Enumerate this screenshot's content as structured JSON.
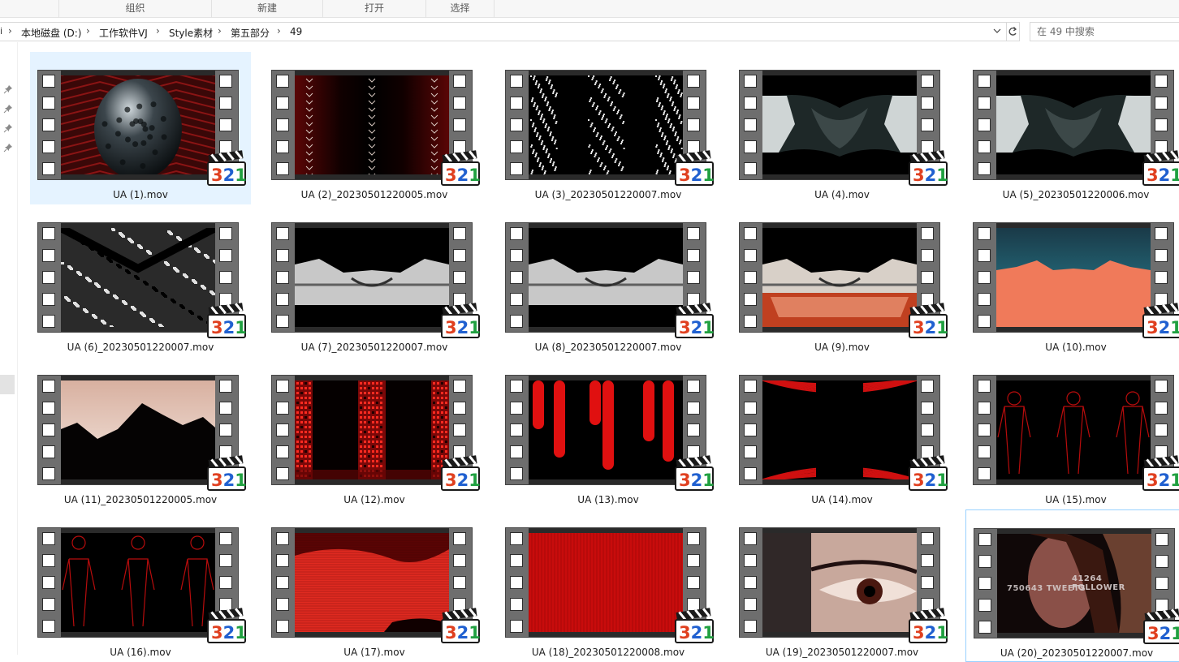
{
  "ribbon": {
    "groups": [
      "组织",
      "新建",
      "打开",
      "选择"
    ]
  },
  "address_bar": {
    "breadcrumbs": [
      "本地磁盘 (D:)",
      "工作软件VJ",
      "Style素材",
      "第五部分",
      "49"
    ]
  },
  "search": {
    "placeholder": "在 49 中搜索"
  },
  "files": [
    {
      "name": "UA (1).mov",
      "preview": "orb"
    },
    {
      "name": "UA (2)_20230501220005.mov",
      "preview": "dark-red-symmetry"
    },
    {
      "name": "UA (3)_20230501220007.mov",
      "preview": "white-noise-columns"
    },
    {
      "name": "UA (4).mov",
      "preview": "grey-cave"
    },
    {
      "name": "UA (5)_20230501220006.mov",
      "preview": "grey-cave-2"
    },
    {
      "name": "UA (6)_20230501220007.mov",
      "preview": "bw-texture"
    },
    {
      "name": "UA (7)_20230501220007.mov",
      "preview": "mirror-mountain"
    },
    {
      "name": "UA (8)_20230501220007.mov",
      "preview": "mirror-mountain"
    },
    {
      "name": "UA (9).mov",
      "preview": "mirror-mountain-warm"
    },
    {
      "name": "UA (10).mov",
      "preview": "coral-desert"
    },
    {
      "name": "UA (11)_20230501220005.mov",
      "preview": "sunset-silhouette"
    },
    {
      "name": "UA (12).mov",
      "preview": "red-lights-columns"
    },
    {
      "name": "UA (13).mov",
      "preview": "red-drips"
    },
    {
      "name": "UA (14).mov",
      "preview": "red-arcs"
    },
    {
      "name": "UA (15).mov",
      "preview": "red-figures"
    },
    {
      "name": "UA (16).mov",
      "preview": "red-outline-figures"
    },
    {
      "name": "UA (17).mov",
      "preview": "red-glitch"
    },
    {
      "name": "UA (18)_20230501220008.mov",
      "preview": "red-solid"
    },
    {
      "name": "UA (19)_20230501220007.mov",
      "preview": "eye"
    },
    {
      "name": "UA (20)_20230501220007.mov",
      "preview": "face-text",
      "overlay_text": [
        "41264 FOLLOWER",
        "750643 TWEETS"
      ]
    }
  ],
  "clapper": {
    "text": "321"
  },
  "colors": {
    "selection": "#e5f3ff",
    "focus_border": "#99d1ff",
    "film_strip": "#6e6e6e",
    "clapper_red": "#e04020",
    "clapper_blue": "#2060d0",
    "clapper_green": "#20a040"
  }
}
